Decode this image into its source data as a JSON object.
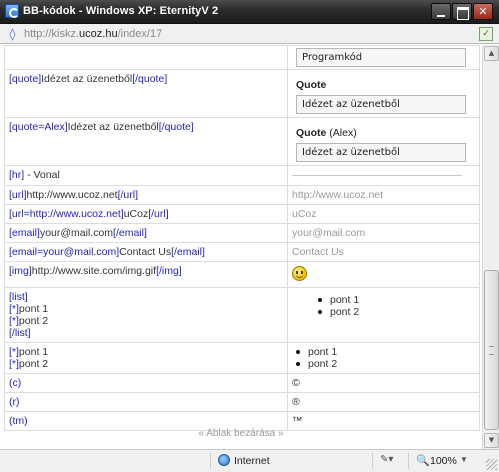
{
  "window": {
    "title": "BB-kódok - Windows XP: EternityV 2"
  },
  "address": {
    "url_prefix": "http://kiskz.",
    "url_host": "ucoz.hu",
    "url_path": "/index/17"
  },
  "rows": [
    {
      "right_code": "Programkód"
    },
    {
      "tag_open": "[quote]",
      "text": "Idézet az üzenetből",
      "tag_close": "[/quote]",
      "quote_label": "Quote",
      "quote_text": "Idézet az üzenetből"
    },
    {
      "tag_open": "[quote=Alex]",
      "text": "Idézet az üzenetből",
      "tag_close": "[/quote]",
      "quote_label": "Quote",
      "quote_author": "(Alex)",
      "quote_text": "Idézet az üzenetből"
    },
    {
      "tag_open": "[hr]",
      "text": " - Vonal"
    },
    {
      "tag_open": "[url]",
      "text": "http://www.ucoz.net",
      "tag_close": "[/url]",
      "result": "http://www.ucoz.net"
    },
    {
      "tag_open": "[url=http://www.ucoz.net]",
      "text": "uCoz",
      "tag_close": "[/url]",
      "result": "uCoz"
    },
    {
      "tag_open": "[email]",
      "text": "your@mail.com",
      "tag_close": "[/email]",
      "result": "your@mail.com"
    },
    {
      "tag_open": "[email=your@mail.com]",
      "text": "Contact Us",
      "tag_close": "[/email]",
      "result": "Contact Us"
    },
    {
      "tag_open": "[img]",
      "text": "http://www.site.com/img.gif",
      "tag_close": "[/img]"
    },
    {
      "tag_open": "[list]",
      "item1_tag": "[*]",
      "item1": "pont 1",
      "item2_tag": "[*]",
      "item2": "pont 2",
      "tag_close": "[/list]",
      "result_items": [
        "pont 1",
        "pont 2"
      ]
    },
    {
      "item1_tag": "[*]",
      "item1": "pont 1",
      "item2_tag": "[*]",
      "item2": "pont 2",
      "result_items": [
        "pont 1",
        "pont 2"
      ]
    },
    {
      "tag_open": "(c)",
      "result": "©"
    },
    {
      "tag_open": "(r)",
      "result": "®"
    },
    {
      "tag_open": "(tm)",
      "result": "™"
    }
  ],
  "close_link": "« Ablak bezárása »",
  "status": {
    "zone": "Internet",
    "zoom": "100%"
  },
  "icons": [
    "app-icon",
    "minimize-icon",
    "maximize-icon",
    "close-icon",
    "page-icon",
    "globe-icon",
    "zoom-icon",
    "smiley-icon"
  ]
}
